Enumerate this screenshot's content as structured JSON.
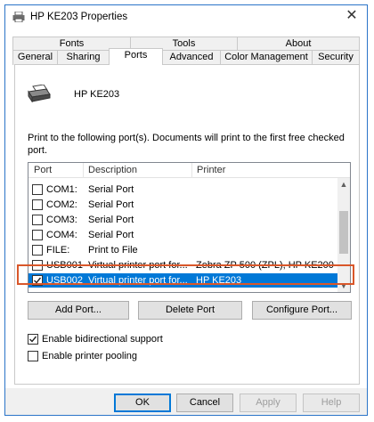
{
  "window": {
    "title": "HP KE203 Properties",
    "close_icon": "close-icon"
  },
  "tabs_row1": [
    "Fonts",
    "Tools",
    "About"
  ],
  "tabs_row2": [
    "General",
    "Sharing",
    "Ports",
    "Advanced",
    "Color Management",
    "Security"
  ],
  "active_tab": "Ports",
  "printer": {
    "name": "HP KE203"
  },
  "description": "Print to the following port(s). Documents will print to the first free checked port.",
  "ports_list": {
    "columns": [
      "Port",
      "Description",
      "Printer"
    ],
    "rows": [
      {
        "checked": false,
        "port": "COM1:",
        "description": "Serial Port",
        "printer": ""
      },
      {
        "checked": false,
        "port": "COM2:",
        "description": "Serial Port",
        "printer": ""
      },
      {
        "checked": false,
        "port": "COM3:",
        "description": "Serial Port",
        "printer": ""
      },
      {
        "checked": false,
        "port": "COM4:",
        "description": "Serial Port",
        "printer": ""
      },
      {
        "checked": false,
        "port": "FILE:",
        "description": "Print to File",
        "printer": ""
      },
      {
        "checked": false,
        "port": "USB001",
        "description": "Virtual printer port for...",
        "printer": "Zebra ZP 500 (ZPL), HP KE200"
      },
      {
        "checked": true,
        "port": "USB002",
        "description": "Virtual printer port for...",
        "printer": "HP KE203",
        "selected": true
      }
    ]
  },
  "port_buttons": {
    "add": "Add Port...",
    "delete": "Delete Port",
    "configure": "Configure Port..."
  },
  "options": {
    "bidirectional": {
      "label": "Enable bidirectional support",
      "checked": true
    },
    "pooling": {
      "label": "Enable printer pooling",
      "checked": false
    }
  },
  "footer_buttons": {
    "ok": "OK",
    "cancel": "Cancel",
    "apply": "Apply",
    "help": "Help"
  },
  "colors": {
    "selection": "#0078d7",
    "highlight_box": "#d9572a",
    "window_border": "#2b74c8"
  }
}
